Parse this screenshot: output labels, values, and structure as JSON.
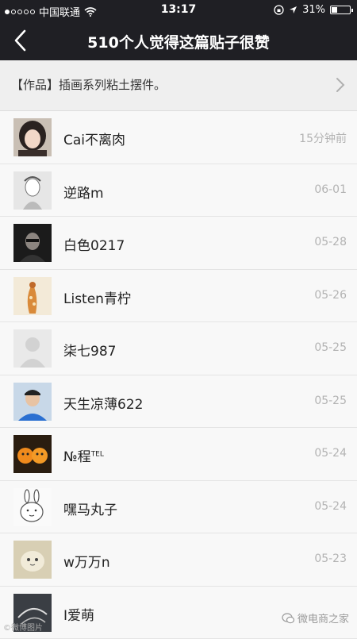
{
  "status_bar": {
    "carrier": "中国联通",
    "time": "13:17",
    "battery_text": "31%",
    "battery_level": 0.31,
    "signal_bars_on": 1,
    "signal_bars_total": 5
  },
  "nav": {
    "title": "510个人觉得这篇贴子很赞",
    "back_icon": "chevron-left-icon"
  },
  "post": {
    "label": "【作品】插画系列粘土摆件。",
    "chevron_icon": "chevron-right-icon"
  },
  "likers": [
    {
      "name": "Cai不离肉",
      "time": "15分钟前"
    },
    {
      "name": "逆路m",
      "time": "06-01"
    },
    {
      "name": "白色0217",
      "time": "05-28"
    },
    {
      "name": "Listen青柠",
      "time": "05-26"
    },
    {
      "name": "柒七987",
      "time": "05-25"
    },
    {
      "name": "天生凉薄622",
      "time": "05-25"
    },
    {
      "name": "№程",
      "name_sup": "TEL",
      "time": "05-24"
    },
    {
      "name": "嘿马丸子",
      "time": "05-24"
    },
    {
      "name": "w万万n",
      "time": "05-23"
    },
    {
      "name": "I爱萌",
      "time": ""
    }
  ],
  "watermarks": {
    "left": "©微博图片",
    "right": "微电商之家"
  },
  "colors": {
    "header_bg": "#1f1f24",
    "list_bg": "#f8f8f8",
    "time_text": "#b3b3b3"
  }
}
